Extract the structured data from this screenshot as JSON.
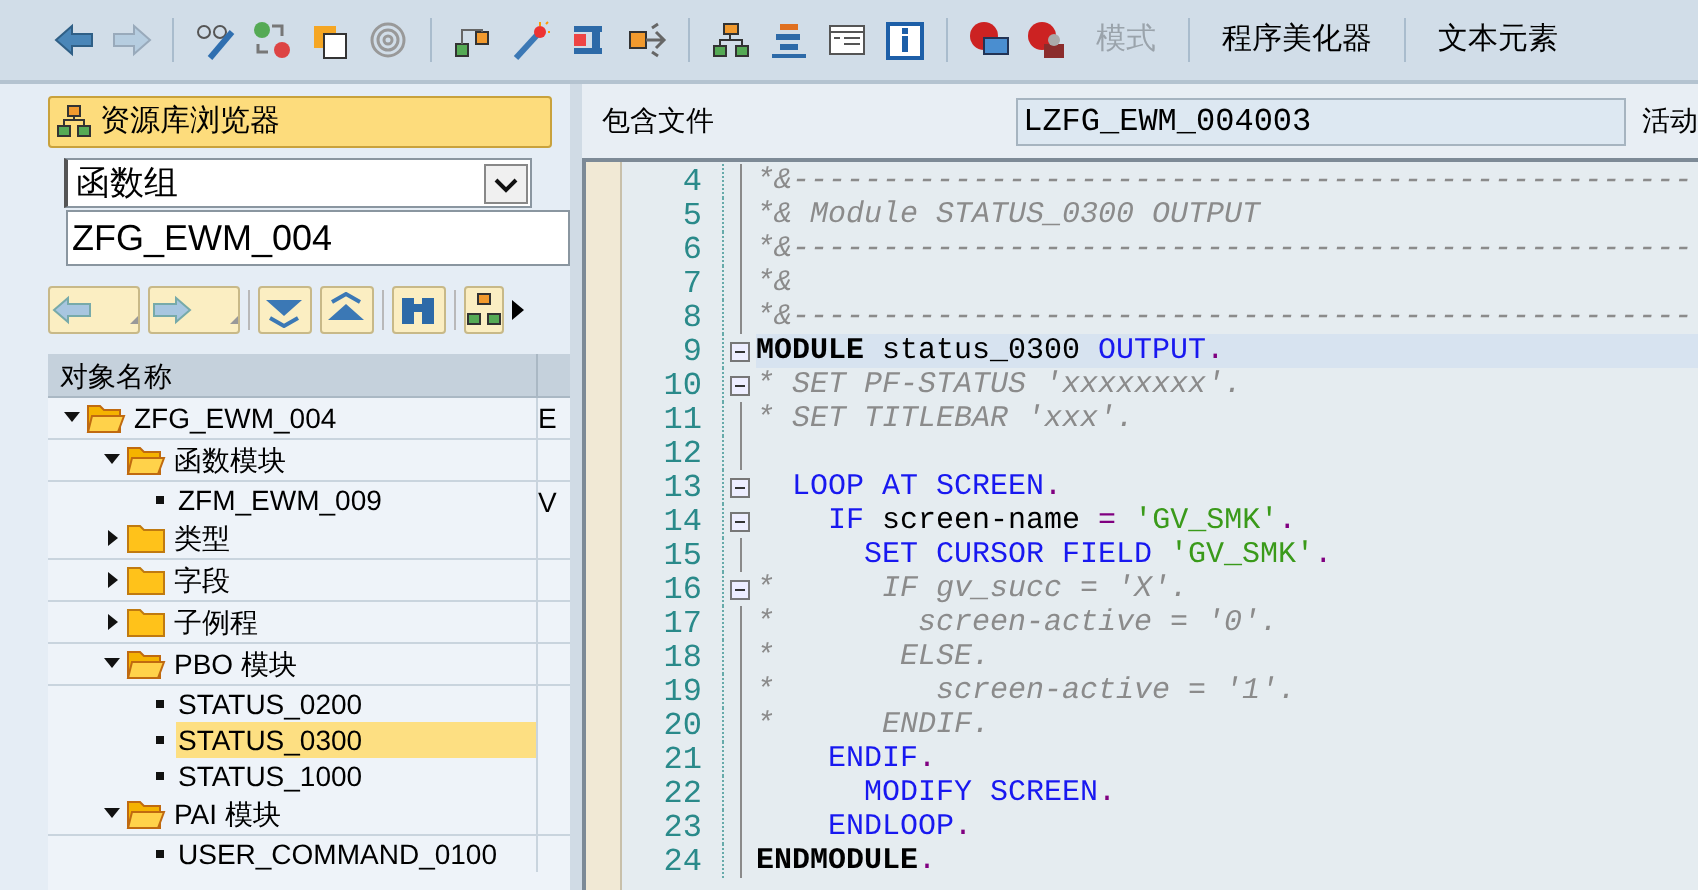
{
  "toolbar": {
    "buttons": [
      {
        "label": "模式",
        "disabled": true
      },
      {
        "label": "程序美化器",
        "disabled": false
      },
      {
        "label": "文本元素",
        "disabled": false
      }
    ]
  },
  "browser": {
    "title": "资源库浏览器",
    "object_type": "函数组",
    "object_name": "ZFG_EWM_004",
    "tree": {
      "column_1": "对象名称",
      "nodes": [
        {
          "label": "ZFG_EWM_004",
          "column_2": "E",
          "expanded": true,
          "selected": false,
          "children": [
            {
              "label": "函数模块",
              "expanded": true,
              "selected": false,
              "children": [
                {
                  "label": "ZFM_EWM_009",
                  "column_2": "V",
                  "selected": false
                }
              ]
            },
            {
              "label": "类型",
              "expanded": false,
              "selected": false
            },
            {
              "label": "字段",
              "expanded": false,
              "selected": false
            },
            {
              "label": "子例程",
              "expanded": false,
              "selected": false
            },
            {
              "label": "PBO 模块",
              "expanded": true,
              "selected": false,
              "children": [
                {
                  "label": "STATUS_0200",
                  "selected": false
                },
                {
                  "label": "STATUS_0300",
                  "selected": true
                },
                {
                  "label": "STATUS_1000",
                  "selected": false
                }
              ]
            },
            {
              "label": "PAI 模块",
              "expanded": true,
              "selected": false,
              "children": [
                {
                  "label": "USER_COMMAND_0100",
                  "selected": false
                }
              ]
            }
          ]
        }
      ]
    }
  },
  "editor": {
    "include_label": "包含文件",
    "include_name": "LZFG_EWM_004003",
    "status": "活动",
    "lines": [
      {
        "number": "4",
        "collapsible": false,
        "selected": false,
        "tokens": [
          {
            "kind": "comment",
            "text": "*&--------------------------------------------------"
          }
        ]
      },
      {
        "number": "5",
        "collapsible": false,
        "selected": false,
        "tokens": [
          {
            "kind": "comment",
            "text": "*& Module STATUS_0300 OUTPUT"
          }
        ]
      },
      {
        "number": "6",
        "collapsible": false,
        "selected": false,
        "tokens": [
          {
            "kind": "comment",
            "text": "*&--------------------------------------------------"
          }
        ]
      },
      {
        "number": "7",
        "collapsible": false,
        "selected": false,
        "tokens": [
          {
            "kind": "comment",
            "text": "*&"
          }
        ]
      },
      {
        "number": "8",
        "collapsible": false,
        "selected": false,
        "tokens": [
          {
            "kind": "comment",
            "text": "*&--------------------------------------------------"
          }
        ]
      },
      {
        "number": "9",
        "collapsible": true,
        "selected": true,
        "tokens": [
          {
            "kind": "bold",
            "text": "MODULE"
          },
          {
            "kind": "plain",
            "text": " status_0300 "
          },
          {
            "kind": "keyword",
            "text": "OUTPUT"
          },
          {
            "kind": "punct",
            "text": "."
          }
        ]
      },
      {
        "number": "10",
        "collapsible": true,
        "selected": false,
        "tokens": [
          {
            "kind": "comment",
            "text": "* SET PF-STATUS 'xxxxxxxx'."
          }
        ]
      },
      {
        "number": "11",
        "collapsible": false,
        "selected": false,
        "tokens": [
          {
            "kind": "comment",
            "text": "* SET TITLEBAR 'xxx'."
          }
        ]
      },
      {
        "number": "12",
        "collapsible": false,
        "selected": false
      },
      {
        "number": "13",
        "collapsible": true,
        "selected": false,
        "tokens": [
          {
            "kind": "keyword",
            "text": "  LOOP AT SCREEN"
          },
          {
            "kind": "punct",
            "text": "."
          }
        ]
      },
      {
        "number": "14",
        "collapsible": true,
        "selected": false,
        "tokens": [
          {
            "kind": "keyword",
            "text": "    IF"
          },
          {
            "kind": "plain",
            "text": " screen-name "
          },
          {
            "kind": "punct",
            "text": "="
          },
          {
            "kind": "string",
            "text": " 'GV_SMK'"
          },
          {
            "kind": "punct",
            "text": "."
          }
        ]
      },
      {
        "number": "15",
        "collapsible": false,
        "selected": false,
        "tokens": [
          {
            "kind": "keyword",
            "text": "      SET CURSOR FIELD"
          },
          {
            "kind": "string",
            "text": " 'GV_SMK'"
          },
          {
            "kind": "punct",
            "text": "."
          }
        ]
      },
      {
        "number": "16",
        "collapsible": true,
        "selected": false,
        "tokens": [
          {
            "kind": "comment",
            "text": "*      IF gv_succ = 'X'."
          }
        ]
      },
      {
        "number": "17",
        "collapsible": false,
        "selected": false,
        "tokens": [
          {
            "kind": "comment",
            "text": "*        screen-active = '0'."
          }
        ]
      },
      {
        "number": "18",
        "collapsible": false,
        "selected": false,
        "tokens": [
          {
            "kind": "comment",
            "text": "*       ELSE."
          }
        ]
      },
      {
        "number": "19",
        "collapsible": false,
        "selected": false,
        "tokens": [
          {
            "kind": "comment",
            "text": "*         screen-active = '1'."
          }
        ]
      },
      {
        "number": "20",
        "collapsible": false,
        "selected": false,
        "tokens": [
          {
            "kind": "comment",
            "text": "*      ENDIF."
          }
        ]
      },
      {
        "number": "21",
        "collapsible": false,
        "selected": false,
        "tokens": [
          {
            "kind": "keyword",
            "text": "    ENDIF"
          },
          {
            "kind": "punct",
            "text": "."
          }
        ]
      },
      {
        "number": "22",
        "collapsible": false,
        "selected": false,
        "tokens": [
          {
            "kind": "keyword",
            "text": "      MODIFY SCREEN"
          },
          {
            "kind": "punct",
            "text": "."
          }
        ]
      },
      {
        "number": "23",
        "collapsible": false,
        "selected": false,
        "tokens": [
          {
            "kind": "keyword",
            "text": "    ENDLOOP"
          },
          {
            "kind": "punct",
            "text": "."
          }
        ]
      },
      {
        "number": "24",
        "collapsible": false,
        "selected": false,
        "tokens": [
          {
            "kind": "bold",
            "text": "ENDMODULE"
          },
          {
            "kind": "punct",
            "text": "."
          }
        ]
      }
    ]
  }
}
